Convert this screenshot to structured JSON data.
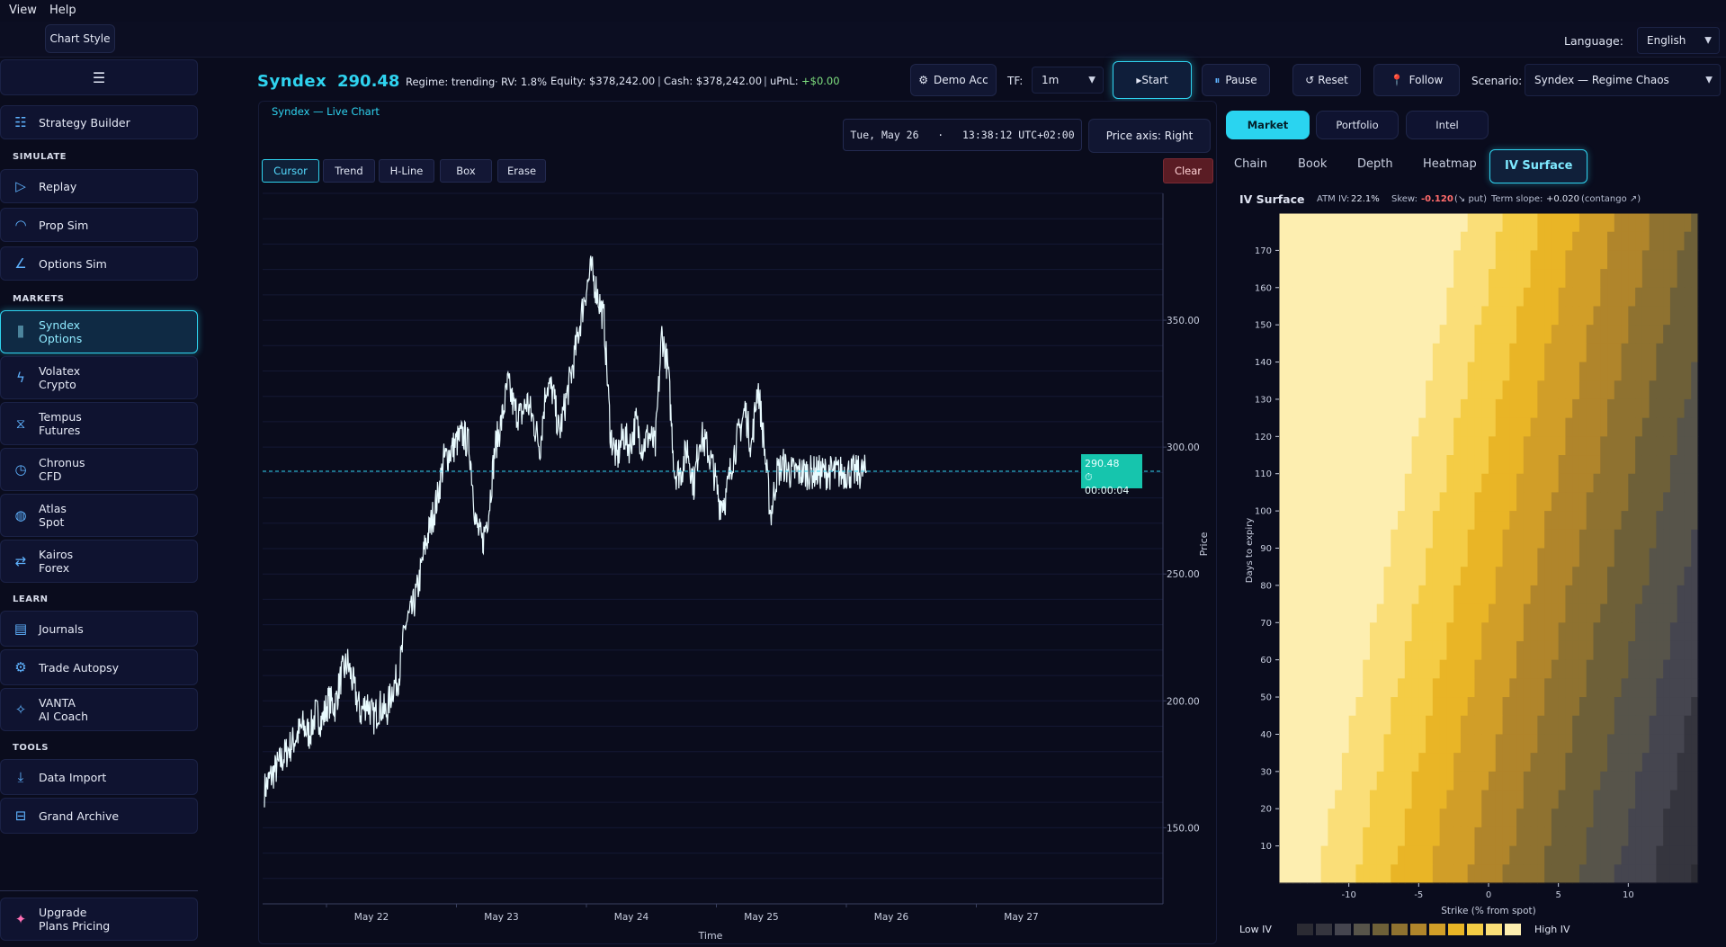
{
  "menu": {
    "view": "View",
    "help": "Help"
  },
  "toolbar": {
    "chart_style": "Chart Style",
    "language_label": "Language:",
    "language_value": "English"
  },
  "header": {
    "ticker": "Syndex",
    "price": "290.48",
    "regime": "Regime: trending",
    "rv": "RV: 1.8%",
    "equity": "Equity: $378,242.00",
    "cash": "Cash: $378,242.00",
    "upnl_label": "uPnL:",
    "upnl_value": "+$0.00",
    "demo_acc": "Demo Acc",
    "tf_label": "TF:",
    "tf_value": "1m",
    "start": "▸Start",
    "pause": "Pause",
    "reset": "Reset",
    "follow": "Follow",
    "scenario_label": "Scenario:",
    "scenario_value": "Syndex — Regime Chaos"
  },
  "sidebar": {
    "menu_icon": "hamburger-icon",
    "strategy_builder": "Strategy Builder",
    "sections": {
      "simulate": "SIMULATE",
      "markets": "MARKETS",
      "learn": "LEARN",
      "tools": "TOOLS"
    },
    "simulate": [
      {
        "label": "Replay",
        "icon": "play-icon"
      },
      {
        "label": "Prop Sim",
        "icon": "gauge-icon"
      },
      {
        "label": "Options Sim",
        "icon": "curve-icon"
      }
    ],
    "markets": [
      {
        "l1": "Syndex",
        "l2": "Options",
        "icon": "candles-icon"
      },
      {
        "l1": "Volatex",
        "l2": "Crypto",
        "icon": "bolt-icon"
      },
      {
        "l1": "Tempus",
        "l2": "Futures",
        "icon": "hourglass-icon"
      },
      {
        "l1": "Chronus",
        "l2": "CFD",
        "icon": "clock-icon"
      },
      {
        "l1": "Atlas",
        "l2": "Spot",
        "icon": "globe-icon"
      },
      {
        "l1": "Kairos",
        "l2": "Forex",
        "icon": "swap-icon"
      }
    ],
    "learn": [
      {
        "l1": "Journals",
        "l2": "",
        "icon": "journal-icon"
      },
      {
        "l1": "Trade Autopsy",
        "l2": "",
        "icon": "autopsy-icon"
      },
      {
        "l1": "VANTA",
        "l2": "AI Coach",
        "icon": "sparkle-icon"
      }
    ],
    "tools": [
      {
        "label": "Data Import",
        "icon": "download-icon"
      },
      {
        "label": "Grand Archive",
        "icon": "archive-icon"
      }
    ],
    "upgrade_l1": "Upgrade",
    "upgrade_l2": "Plans  Pricing"
  },
  "chart": {
    "title": "Syndex — Live Chart",
    "datetime": "Tue, May 26   ·   13:38:12 UTC+02:00",
    "price_axis": "Price axis: Right",
    "tools": [
      "Cursor",
      "Trend",
      "H-Line",
      "Box",
      "Erase"
    ],
    "clear": "Clear",
    "last_price": "290.48",
    "countdown": "⏱ 00:00:04",
    "ylabel": "Price",
    "xlabel": "Time"
  },
  "chart_data": [
    {
      "type": "line",
      "title": "Syndex — Live Chart",
      "xlabel": "Time",
      "ylabel": "Price",
      "x_ticks": [
        "May 22",
        "May 23",
        "May 24",
        "May 25",
        "May 26",
        "May 27"
      ],
      "y_ticks": [
        "150.00",
        "200.00",
        "250.00",
        "300.00",
        "350.00"
      ],
      "ylim": [
        120,
        400
      ],
      "last": 290.48,
      "series": [
        {
          "x": [
            0,
            0.05,
            0.1,
            0.15,
            0.2,
            0.25,
            0.3,
            0.35,
            0.4,
            0.45,
            0.5,
            0.55,
            0.6,
            0.65,
            0.7,
            0.75,
            0.8,
            0.85,
            0.9,
            0.95,
            1.0,
            1.05,
            1.1,
            1.15,
            1.2,
            1.25,
            1.3,
            1.35,
            1.4,
            1.45,
            1.5,
            1.55,
            1.6,
            1.65,
            1.7,
            1.75,
            1.8,
            1.85,
            1.9,
            1.95,
            2.0,
            2.05,
            2.1,
            2.15,
            2.2,
            2.25,
            2.3,
            2.35,
            2.4,
            2.45,
            2.5,
            2.55,
            2.6,
            2.65,
            2.7,
            2.75,
            2.8,
            2.85,
            2.9,
            2.95,
            3.0,
            3.05,
            3.1,
            3.15,
            3.2,
            3.25,
            3.3,
            3.35,
            3.4,
            3.45,
            3.5,
            3.55,
            3.6,
            3.65,
            3.7,
            3.75,
            3.8,
            3.85,
            3.9,
            3.95,
            4.0,
            4.05,
            4.1,
            4.15,
            4.2,
            4.25,
            4.3,
            4.35,
            4.4,
            4.45,
            4.5,
            4.55,
            4.6,
            4.65,
            4.7
          ],
          "y": [
            165,
            170,
            174,
            178,
            182,
            186,
            190,
            187,
            195,
            192,
            200,
            198,
            210,
            215,
            205,
            195,
            200,
            193,
            198,
            195,
            205,
            210,
            230,
            235,
            245,
            260,
            270,
            280,
            295,
            298,
            302,
            305,
            300,
            270,
            262,
            275,
            300,
            310,
            325,
            315,
            312,
            318,
            310,
            300,
            325,
            322,
            305,
            318,
            330,
            345,
            360,
            370,
            360,
            350,
            305,
            295,
            305,
            300,
            310,
            300,
            305,
            300,
            345,
            330,
            290,
            290,
            300,
            285,
            305,
            300,
            292,
            278,
            280,
            295,
            305,
            315,
            300,
            325,
            300,
            273,
            290,
            293,
            290,
            290,
            290,
            290,
            290,
            290,
            290,
            290,
            290,
            290,
            290,
            290,
            290.48
          ]
        }
      ]
    },
    {
      "type": "heatmap",
      "title": "IV Surface",
      "xlabel": "Strike (% from spot)",
      "ylabel": "Days to expiry",
      "x_ticks": [
        "-10",
        "-5",
        "0",
        "5",
        "10"
      ],
      "y_ticks": [
        "10",
        "20",
        "30",
        "40",
        "50",
        "60",
        "70",
        "80",
        "90",
        "100",
        "110",
        "120",
        "130",
        "140",
        "150",
        "160",
        "170"
      ],
      "xlim": [
        -15,
        15
      ],
      "ylim": [
        0,
        180
      ],
      "atm_iv": "22.1%",
      "skew": "-0.120",
      "term_slope": "+0.020"
    }
  ],
  "right": {
    "tabs": [
      "Market",
      "Portfolio",
      "Intel"
    ],
    "subtabs": [
      "Chain",
      "Book",
      "Depth",
      "Heatmap",
      "IV Surface"
    ],
    "iv_title": "IV Surface",
    "atm_label": "ATM IV:",
    "atm_value": "22.1%",
    "skew_label": "Skew:",
    "skew_value": "-0.120",
    "skew_note": "(↘ put)",
    "term_label": "Term slope:",
    "term_value": "+0.020",
    "term_note": "(contango ↗)",
    "low_iv": "Low IV",
    "high_iv": "High IV",
    "legend_colors": [
      "#2b2b33",
      "#35353e",
      "#45454f",
      "#57544a",
      "#6e6038",
      "#8f7230",
      "#b0852b",
      "#d19e28",
      "#e9b526",
      "#f4cc45",
      "#fade78",
      "#fdeeb0"
    ]
  },
  "colors": {
    "accent": "#2fd3ef",
    "line": "#e9fbff",
    "upnl": "#7fe07f",
    "skew": "#ff6b6b",
    "clear": "#5a1c24"
  }
}
